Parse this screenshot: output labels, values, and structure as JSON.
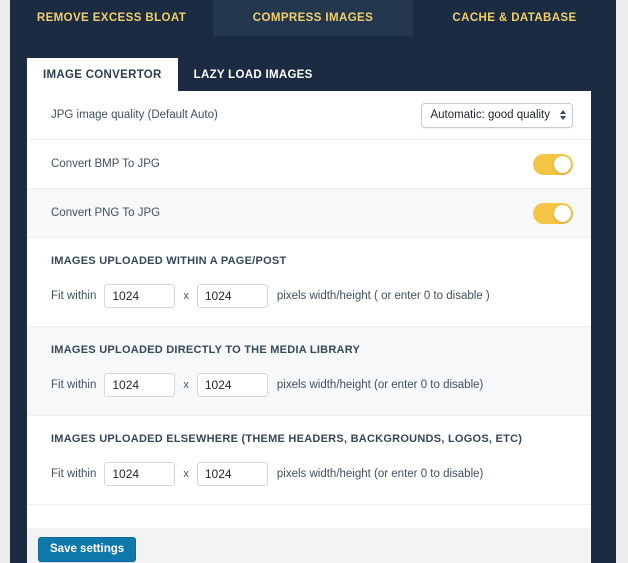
{
  "topnav": {
    "tabs": [
      {
        "label": "REMOVE EXCESS BLOAT",
        "active": false
      },
      {
        "label": "COMPRESS IMAGES",
        "active": true
      },
      {
        "label": "CACHE & DATABASE",
        "active": false
      }
    ]
  },
  "subtabs": [
    {
      "label": "IMAGE CONVERTOR",
      "active": true
    },
    {
      "label": "LAZY LOAD IMAGES",
      "active": false
    }
  ],
  "settings": {
    "jpg_quality": {
      "label": "JPG image quality (Default Auto)",
      "value": "Automatic: good quality"
    },
    "convert_bmp": {
      "label": "Convert BMP To JPG",
      "state": "on"
    },
    "convert_png": {
      "label": "Convert PNG To JPG",
      "state": "on"
    }
  },
  "sections": [
    {
      "title": "IMAGES UPLOADED WITHIN A PAGE/POST",
      "fit_label": "Fit within",
      "width": "1024",
      "separator": "x",
      "height": "1024",
      "suffix": "pixels width/height ( or enter 0 to disable )"
    },
    {
      "title": "IMAGES UPLOADED DIRECTLY TO THE MEDIA LIBRARY",
      "fit_label": "Fit within",
      "width": "1024",
      "separator": "x",
      "height": "1024",
      "suffix": "pixels width/height (or enter 0 to disable)"
    },
    {
      "title": "IMAGES UPLOADED ELSEWHERE (THEME HEADERS, BACKGROUNDS, LOGOS, ETC)",
      "fit_label": "Fit within",
      "width": "1024",
      "separator": "x",
      "height": "1024",
      "suffix": "pixels width/height (or enter 0 to disable)"
    }
  ],
  "footer": {
    "save_label": "Save settings"
  },
  "colors": {
    "navy": "#1b2b41",
    "navy_active": "#23384f",
    "gold": "#f3cf6a",
    "toggle_on": "#f4c444",
    "save_blue": "#1079ab",
    "page_bg": "#edecec"
  }
}
